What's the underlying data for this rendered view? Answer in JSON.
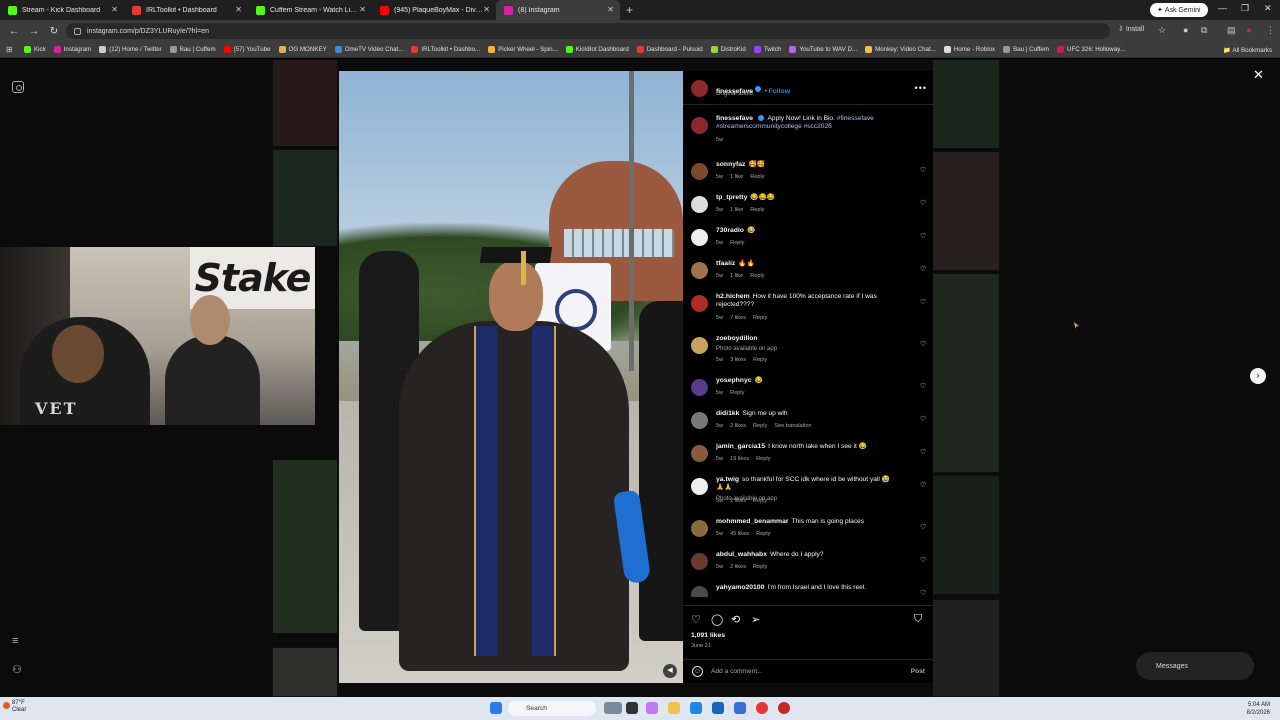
{
  "browser": {
    "tabs": [
      {
        "label": "Stream - Kick Dashboard",
        "color": "#53fc18"
      },
      {
        "label": "IRLToolkit • Dashboard",
        "color": "#e53935"
      },
      {
        "label": "Cuffem Stream - Watch Live on",
        "color": "#53fc18"
      },
      {
        "label": "(945) PlaqueBoyMax - Diva (Offi",
        "color": "#ff0000"
      },
      {
        "label": "(8) Instagram",
        "color": "#d6249f"
      }
    ],
    "new_tab": "+",
    "gemini_label": "Ask Gemini",
    "url": "instagram.com/p/DZ3YLURuyIe/?hl=en",
    "install_label": "Install",
    "bookmarks": [
      {
        "label": "Kick",
        "color": "#53fc18"
      },
      {
        "label": "Instagram",
        "color": "#d6249f"
      },
      {
        "label": "(12) Home / Twitter",
        "color": "#cccccc"
      },
      {
        "label": "Bau | Cuffem",
        "color": "#999999"
      },
      {
        "label": "(57) YouTube",
        "color": "#ff0000"
      },
      {
        "label": "OG MONKEY",
        "color": "#e0b060"
      },
      {
        "label": "OmeTV Video Chat...",
        "color": "#3b8bd9"
      },
      {
        "label": "IRLToolkit • Dashbo...",
        "color": "#e53935"
      },
      {
        "label": "Picker Wheel - Spin...",
        "color": "#f2b134"
      },
      {
        "label": "KickBot Dashboard",
        "color": "#53fc18"
      },
      {
        "label": "Dashboard - Pulsoid",
        "color": "#e53935"
      },
      {
        "label": "DistroKid",
        "color": "#9bd13a"
      },
      {
        "label": "Twitch",
        "color": "#9146ff"
      },
      {
        "label": "YouTube to WAV D...",
        "color": "#b565f0"
      },
      {
        "label": "Monkey: Video Chat...",
        "color": "#f0c040"
      },
      {
        "label": "Home - Roblox",
        "color": "#dddddd"
      },
      {
        "label": "Bau | Cuffem",
        "color": "#999999"
      },
      {
        "label": "UFC 326: Holloway...",
        "color": "#d4145a"
      }
    ],
    "all_bookmarks": "All Bookmarks"
  },
  "webcam": {
    "sign_text": "Stake",
    "shirt_text": "VET"
  },
  "post": {
    "author": "finessefave",
    "follow_label": "Follow",
    "audio": "Original audio",
    "caption": {
      "user": "finessefave",
      "text": "Apply Now! Link in Bio.",
      "hashtags": "#finessefave #streamerscommunitycollege #scc2026",
      "age": "5w"
    },
    "comments": [
      {
        "user": "sonnyfaz",
        "text": "🥰🥰",
        "age": "5w",
        "likes": "1 like",
        "reply": "Reply",
        "translate": "",
        "avatar": "#7a4a2a"
      },
      {
        "user": "tp_tpretty",
        "text": "😂😂😂",
        "age": "5w",
        "likes": "1 like",
        "reply": "Reply",
        "translate": "",
        "avatar": "#dddddd"
      },
      {
        "user": "730radio",
        "text": "😂",
        "age": "5w",
        "likes": "",
        "reply": "Reply",
        "translate": "",
        "avatar": "#eeeeee"
      },
      {
        "user": "tfaaiiz",
        "text": "🔥🔥",
        "age": "5w",
        "likes": "1 like",
        "reply": "Reply",
        "translate": "",
        "avatar": "#a07050"
      },
      {
        "user": "h2.hichem",
        "text": "How it have 100% acceptance rate if I was rejected????",
        "age": "5w",
        "likes": "7 likes",
        "reply": "Reply",
        "translate": "",
        "avatar": "#b02a2a"
      },
      {
        "user": "zoeboydillon",
        "text": "",
        "sub": "Photo available on app",
        "age": "5w",
        "likes": "3 likes",
        "reply": "Reply",
        "translate": "",
        "avatar": "#c9a060"
      },
      {
        "user": "yosephnyc",
        "text": "😂",
        "age": "5w",
        "likes": "",
        "reply": "Reply",
        "translate": "",
        "avatar": "#5a3a8a"
      },
      {
        "user": "didi1kk",
        "text": "Sign me up wlh",
        "age": "5w",
        "likes": "2 likes",
        "reply": "Reply",
        "translate": "See translation",
        "avatar": "#777777"
      },
      {
        "user": "jamin_garcia15",
        "text": "I know north lake when I see it 😂",
        "age": "5w",
        "likes": "19 likes",
        "reply": "Reply",
        "translate": "",
        "avatar": "#8a5a3a"
      },
      {
        "user": "ya.twig",
        "text": "so thankful for SCC idk where id be without yall 😭🙏🙏",
        "sub": "Photo available on app",
        "age": "5w",
        "likes": "2 likes",
        "reply": "Reply",
        "translate": "",
        "avatar": "#eeeeee"
      },
      {
        "user": "mohmmed_benammar",
        "text": "This man is going places",
        "age": "5w",
        "likes": "45 likes",
        "reply": "Reply",
        "translate": "",
        "avatar": "#8a6a3a"
      },
      {
        "user": "abdul_wahhabx",
        "text": "Where do I apply?",
        "age": "5w",
        "likes": "2 likes",
        "reply": "Reply",
        "translate": "",
        "avatar": "#6a3a2a"
      },
      {
        "user": "yahyamo20100",
        "text": "I'm from Israel and I love this reel​​.",
        "age": "5w",
        "likes": "",
        "reply": "",
        "translate": "",
        "avatar": "#4a4a4a"
      }
    ],
    "likes": "1,091 likes",
    "date": "June 21",
    "add_comment": "Add a comment...",
    "post_label": "Post"
  },
  "overlay": {
    "messages_label": "Messages"
  },
  "taskbar": {
    "temp": "87°F",
    "condition": "Clear",
    "search": "Search",
    "time": "5:04 AM",
    "date": "8/2/2026"
  }
}
